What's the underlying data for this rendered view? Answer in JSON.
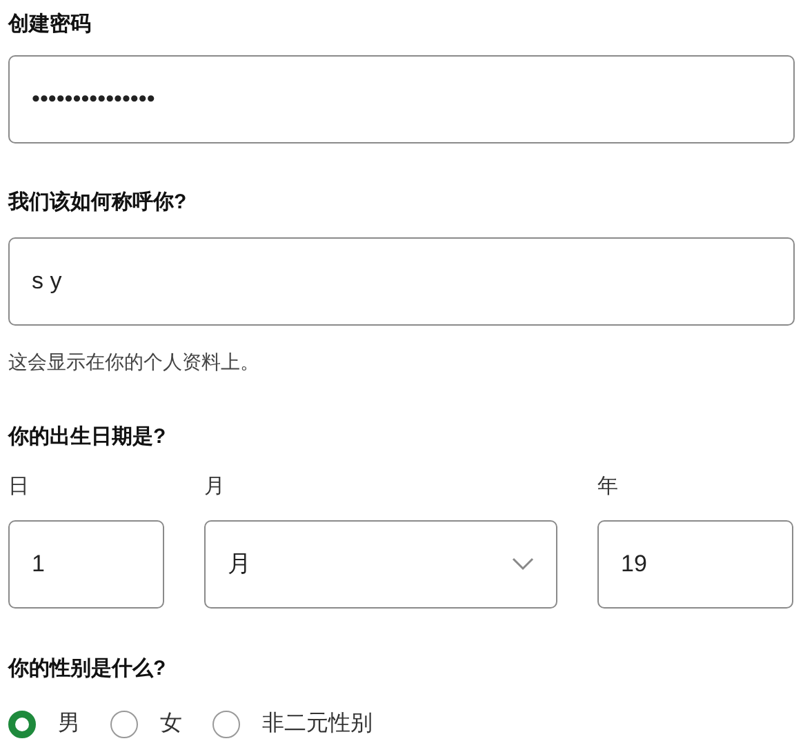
{
  "password": {
    "label": "创建密码",
    "value": "•••••••••••••••"
  },
  "name": {
    "label": "我们该如何称呼你?",
    "value": "s y",
    "hint": "这会显示在你的个人资料上。"
  },
  "birthdate": {
    "label": "你的出生日期是?",
    "day": {
      "label": "日",
      "value": "1"
    },
    "month": {
      "label": "月",
      "value": "月"
    },
    "year": {
      "label": "年",
      "value": "19"
    }
  },
  "gender": {
    "label": "你的性别是什么?",
    "options": [
      {
        "label": "男",
        "selected": true
      },
      {
        "label": "女",
        "selected": false
      },
      {
        "label": "非二元性别",
        "selected": false
      }
    ]
  }
}
